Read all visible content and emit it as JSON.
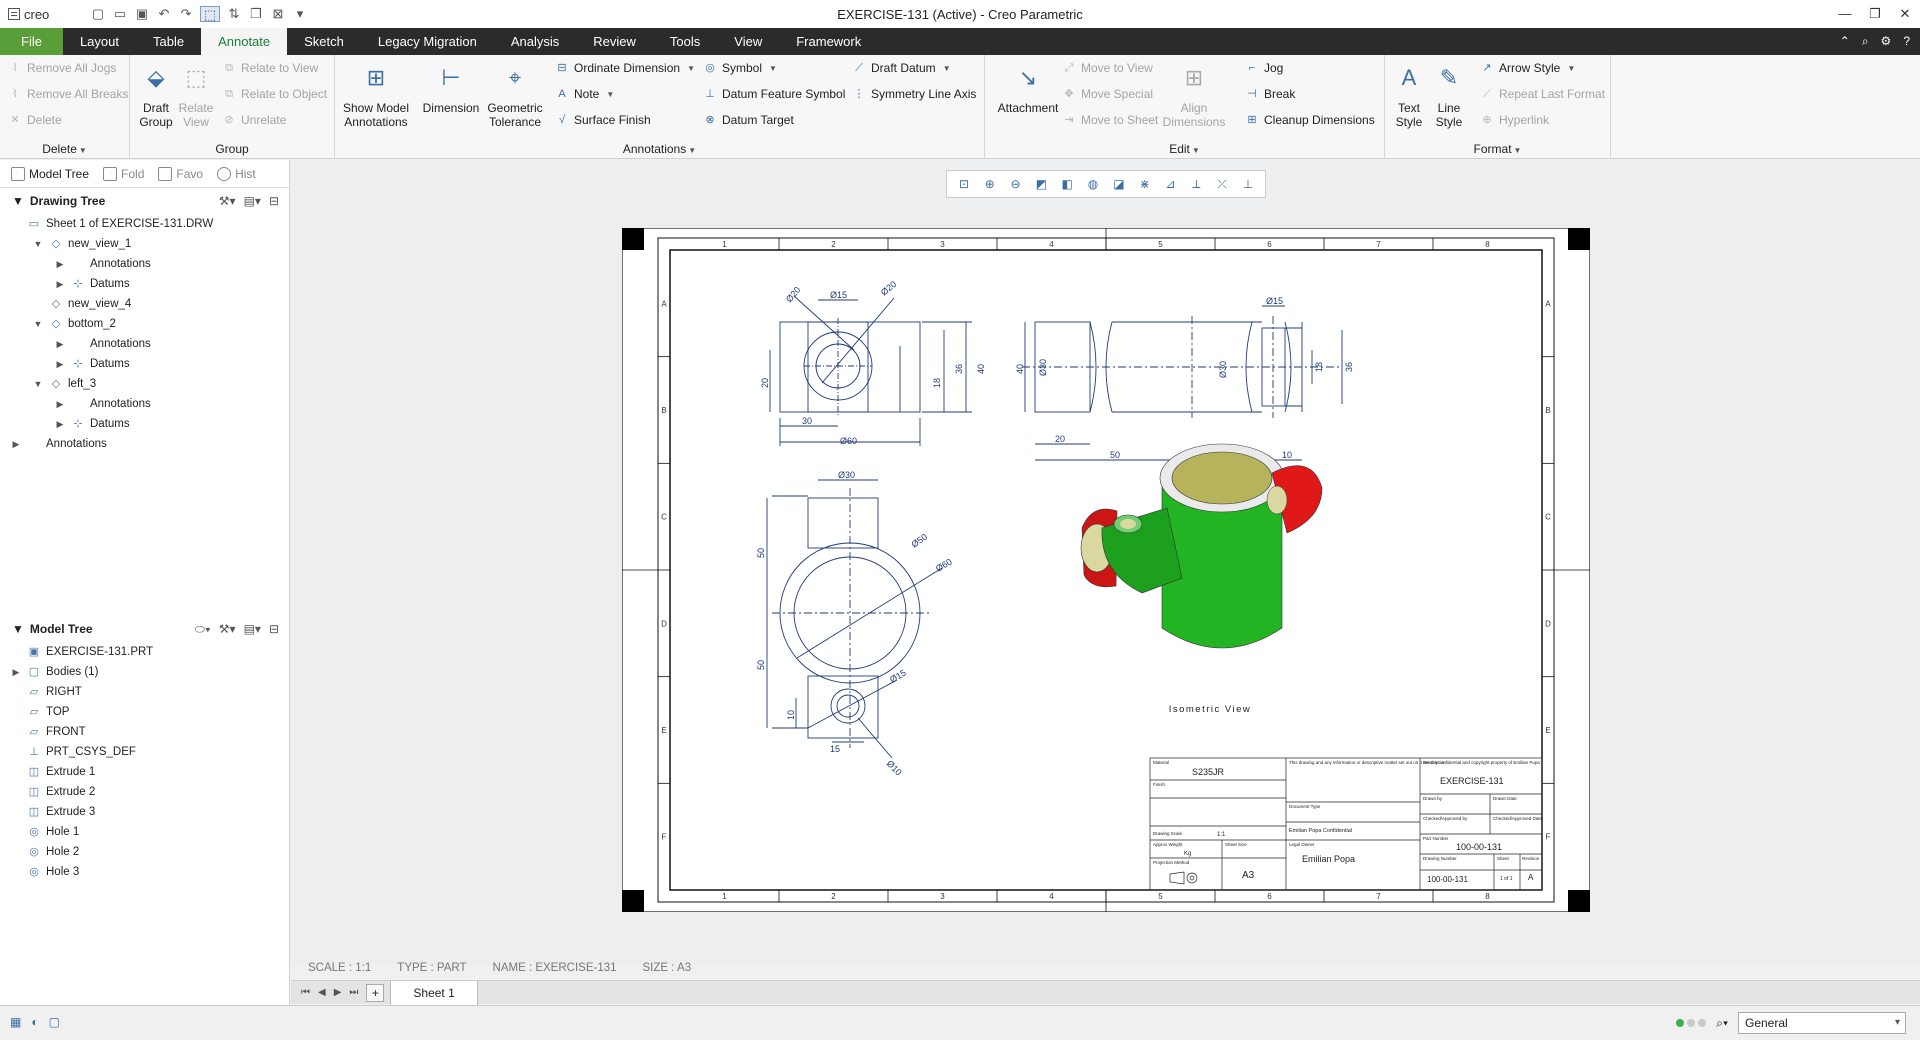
{
  "app": {
    "logo": "creo",
    "title": "EXERCISE-131 (Active) - Creo Parametric"
  },
  "menu": {
    "tabs": [
      "File",
      "Layout",
      "Table",
      "Annotate",
      "Sketch",
      "Legacy Migration",
      "Analysis",
      "Review",
      "Tools",
      "View",
      "Framework"
    ],
    "active": "Annotate"
  },
  "ribbon": {
    "delete_group": {
      "label": "Delete",
      "items": [
        "Remove All Jogs",
        "Remove All Breaks",
        "Delete"
      ]
    },
    "group_group": {
      "label": "Group",
      "draft_group": "Draft\nGroup",
      "relate_view": "Relate\nView",
      "items": [
        "Relate to View",
        "Relate to Object",
        "Unrelate"
      ]
    },
    "annotations_group": {
      "label": "Annotations",
      "show_model": "Show Model\nAnnotations",
      "dimension": "Dimension",
      "geo_tol": "Geometric\nTolerance",
      "col1": [
        "Ordinate Dimension",
        "Note",
        "Surface Finish"
      ],
      "col2": [
        "Symbol",
        "Datum Feature Symbol",
        "Datum Target"
      ],
      "col3": [
        "Draft Datum",
        "Symmetry Line Axis"
      ]
    },
    "edit_group": {
      "label": "Edit",
      "attachment": "Attachment",
      "col1": [
        "Move to View",
        "Move Special",
        "Move to Sheet"
      ],
      "align": "Align\nDimensions",
      "col2": [
        "Jog",
        "Break",
        "Cleanup Dimensions"
      ]
    },
    "format_group": {
      "label": "Format",
      "text_style": "Text\nStyle",
      "line_style": "Line\nStyle",
      "items": [
        "Arrow Style",
        "Repeat Last Format",
        "Hyperlink"
      ]
    }
  },
  "panel": {
    "tabs": [
      "Model Tree",
      "Fold",
      "Favo",
      "Hist"
    ],
    "drawing_tree": {
      "title": "Drawing Tree",
      "rows": [
        {
          "label": "Sheet 1 of EXERCISE-131.DRW",
          "indent": 0,
          "toggle": "",
          "icon": "sheet"
        },
        {
          "label": "new_view_1",
          "indent": 1,
          "toggle": "▼",
          "icon": "view"
        },
        {
          "label": "Annotations",
          "indent": 2,
          "toggle": "▶",
          "icon": ""
        },
        {
          "label": "Datums",
          "indent": 2,
          "toggle": "▶",
          "icon": "datum"
        },
        {
          "label": "new_view_4",
          "indent": 1,
          "toggle": "",
          "icon": "view"
        },
        {
          "label": "bottom_2",
          "indent": 1,
          "toggle": "▼",
          "icon": "view"
        },
        {
          "label": "Annotations",
          "indent": 2,
          "toggle": "▶",
          "icon": ""
        },
        {
          "label": "Datums",
          "indent": 2,
          "toggle": "▶",
          "icon": "datum"
        },
        {
          "label": "left_3",
          "indent": 1,
          "toggle": "▼",
          "icon": "view"
        },
        {
          "label": "Annotations",
          "indent": 2,
          "toggle": "▶",
          "icon": ""
        },
        {
          "label": "Datums",
          "indent": 2,
          "toggle": "▶",
          "icon": "datum"
        },
        {
          "label": "Annotations",
          "indent": 0,
          "toggle": "▶",
          "icon": ""
        }
      ]
    },
    "model_tree": {
      "title": "Model Tree",
      "rows": [
        {
          "label": "EXERCISE-131.PRT",
          "toggle": "",
          "icon": "part"
        },
        {
          "label": "Bodies (1)",
          "toggle": "▶",
          "icon": "body"
        },
        {
          "label": "RIGHT",
          "toggle": "",
          "icon": "plane"
        },
        {
          "label": "TOP",
          "toggle": "",
          "icon": "plane"
        },
        {
          "label": "FRONT",
          "toggle": "",
          "icon": "plane"
        },
        {
          "label": "PRT_CSYS_DEF",
          "toggle": "",
          "icon": "csys"
        },
        {
          "label": "Extrude 1",
          "toggle": "",
          "icon": "extrude"
        },
        {
          "label": "Extrude 2",
          "toggle": "",
          "icon": "extrude"
        },
        {
          "label": "Extrude 3",
          "toggle": "",
          "icon": "extrude"
        },
        {
          "label": "Hole 1",
          "toggle": "",
          "icon": "hole"
        },
        {
          "label": "Hole 2",
          "toggle": "",
          "icon": "hole"
        },
        {
          "label": "Hole 3",
          "toggle": "",
          "icon": "hole"
        }
      ]
    }
  },
  "drawing": {
    "zones_h": [
      "1",
      "2",
      "3",
      "4",
      "5",
      "6",
      "7",
      "8"
    ],
    "zones_v": [
      "A",
      "B",
      "C",
      "D",
      "E",
      "F"
    ],
    "top_view_dims": [
      "Ø15",
      "Ø30",
      "Ø20",
      "36",
      "40",
      "18",
      "20",
      "30",
      "Ø60"
    ],
    "side_view_dims": [
      "Ø15",
      "40",
      "Ø30",
      "Ø30",
      "18",
      "36",
      "20",
      "50",
      "40",
      "10"
    ],
    "bottom_view_dims": [
      "Ø30",
      "Ø50",
      "Ø60",
      "50",
      "50",
      "Ø15",
      "10",
      "15",
      "Ø10"
    ],
    "iso_caption": "Isometric View",
    "title_block": {
      "material_label": "Material",
      "material": "S235JR",
      "finish_label": "Finish",
      "notes": "This drawing and any information or descriptive matter set out on it are the confidential and copyright property of Emilian Popa",
      "description_label": "Description",
      "description": "EXERCISE-131",
      "drawn_label": "Drawn by",
      "date_label": "Drawn Date",
      "checked_label": "Checked/Approved by",
      "checked_date": "Checked/Approved Date",
      "doc_type": "Document Type",
      "confidential": "Emilian Popa Confidential",
      "scale_label": "Drawing Scale",
      "scale": "1:1",
      "weight_label": "Approx Weight",
      "weight": "Kg",
      "legal_label": "Legal Owner",
      "owner": "Emilian Popa",
      "part_label": "Part Number",
      "part": "100-00-131",
      "proj_label": "Projection Method",
      "size_label": "Sheet Size",
      "size": "A3",
      "dwg_label": "Drawing Number",
      "dwg": "100-00-131",
      "sheet_label": "Sheet",
      "sheet": "1 of 1",
      "rev_label": "Revision",
      "rev": "A"
    }
  },
  "status": {
    "scale": "SCALE : 1:1",
    "type": "TYPE : PART",
    "name": "NAME : EXERCISE-131",
    "size": "SIZE : A3"
  },
  "sheet_tab": "Sheet 1",
  "filter": "General",
  "colors": {
    "accent": "#1a7f3a",
    "file_tab": "#5a9e3a",
    "menubar": "#2b2b2b",
    "line": "#1f3a7a",
    "iso_green": "#1fa61f",
    "iso_red": "#e01818"
  }
}
